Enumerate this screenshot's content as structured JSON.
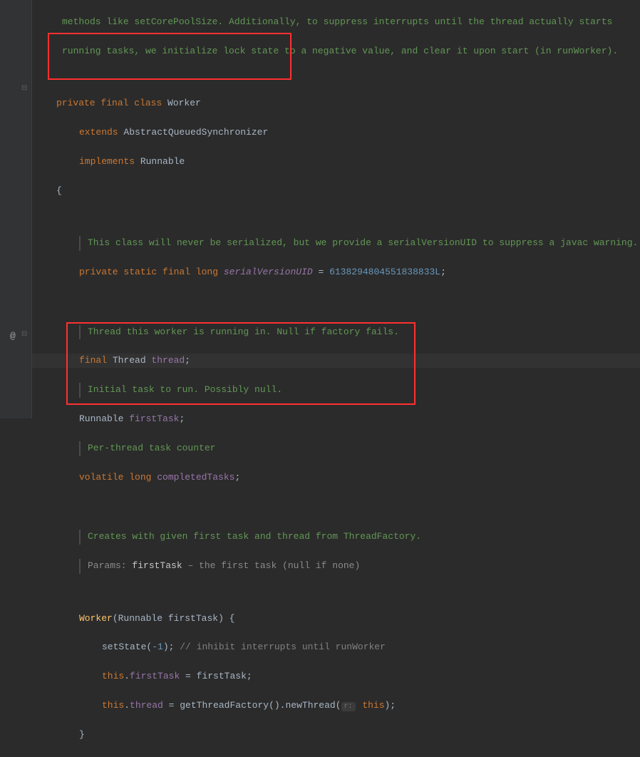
{
  "gutter": {
    "at_symbol": "@",
    "fold1": "⊟",
    "fold2": "⊟"
  },
  "doc_top": {
    "l1": "methods like setCorePoolSize. Additionally, to suppress interrupts until the thread actually starts",
    "l2": "running tasks, we initialize lock state to a negative value, and clear it upon start (in runWorker)."
  },
  "class_decl": {
    "mods": "private final class ",
    "name": "Worker",
    "extends_kw": "extends ",
    "extends_cls": "AbstractQueuedSynchronizer",
    "implements_kw": "implements ",
    "implements_cls": "Runnable"
  },
  "open_brace": "{",
  "serial_doc": "This class will never be serialized, but we provide a serialVersionUID to suppress a javac warning.",
  "serial_line": {
    "mods": "private static final long ",
    "name": "serialVersionUID",
    "eq": " = ",
    "val": "6138294804551838833L",
    "semi": ";"
  },
  "thread_doc": "Thread this worker is running in. Null if factory fails.",
  "thread_line": {
    "mods": "final ",
    "type": "Thread ",
    "name": "thread",
    "semi": ";"
  },
  "firsttask_doc": "Initial task to run. Possibly null.",
  "firsttask_line": {
    "type": "Runnable ",
    "name": "firstTask",
    "semi": ";"
  },
  "completed_doc": "Per-thread task counter",
  "completed_line": {
    "mods": "volatile long ",
    "name": "completedTasks",
    "semi": ";"
  },
  "ctor_doc": {
    "l1": "Creates with given first task and thread from ThreadFactory.",
    "params_label": "Params: ",
    "param_name": "firstTask",
    "param_desc": " – the first task (null if none)"
  },
  "ctor": {
    "name": "Worker",
    "lp": "(",
    "ptype": "Runnable ",
    "pname": "firstTask",
    "rp_brace": ") {",
    "setstate_call": "setState",
    "setstate_arg_l": "(",
    "setstate_arg": "-1",
    "setstate_arg_r": "); ",
    "setstate_cmt": "// inhibit interrupts until runWorker",
    "assign1_this": "this",
    "assign1_dot": ".",
    "assign1_fld": "firstTask",
    "assign1_eq": " = firstTask;",
    "assign2_this": "this",
    "assign2_dot": ".",
    "assign2_fld": "thread",
    "assign2_eq": " = ",
    "assign2_call1": "getThreadFactory",
    "assign2_mid": "().",
    "assign2_call2": "newThread",
    "assign2_lp": "(",
    "assign2_hint": "r:",
    "assign2_arg": " this",
    "assign2_rp": ");",
    "close_brace": "}"
  }
}
